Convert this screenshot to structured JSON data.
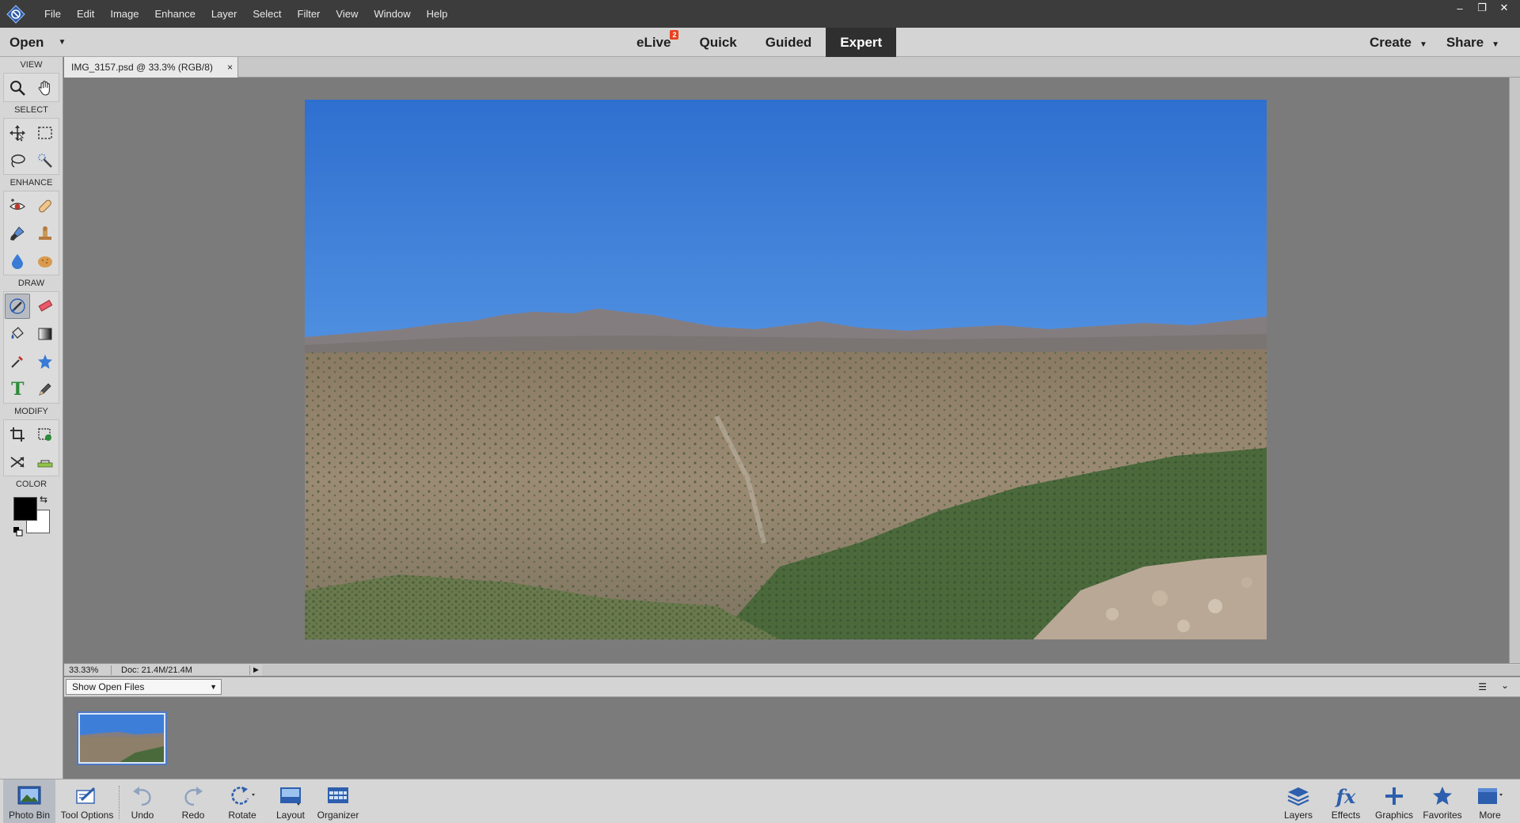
{
  "app": {
    "logo_icon": "photoshop-elements-logo-icon",
    "menu": [
      "File",
      "Edit",
      "Image",
      "Enhance",
      "Layer",
      "Select",
      "Filter",
      "View",
      "Window",
      "Help"
    ],
    "window_controls": {
      "minimize": "–",
      "restore": "❐",
      "close": "✕"
    }
  },
  "modebar": {
    "open_label": "Open",
    "tabs": [
      {
        "label": "eLive",
        "badge": "2"
      },
      {
        "label": "Quick"
      },
      {
        "label": "Guided"
      },
      {
        "label": "Expert",
        "active": true
      }
    ],
    "create_label": "Create",
    "share_label": "Share"
  },
  "toolbox": {
    "sections": {
      "view": "VIEW",
      "select": "SELECT",
      "enhance": "ENHANCE",
      "draw": "DRAW",
      "modify": "MODIFY",
      "color": "COLOR"
    },
    "foreground_color": "#000000",
    "background_color": "#ffffff"
  },
  "document": {
    "tab_title": "IMG_3157.psd @ 33.3% (RGB/8)",
    "close_glyph": "×"
  },
  "status": {
    "zoom": "33.33%",
    "doc_size": "Doc: 21.4M/21.4M"
  },
  "bin": {
    "select_value": "Show Open Files"
  },
  "taskbar": {
    "left": [
      {
        "label": "Photo Bin",
        "icon": "photo-bin-icon"
      },
      {
        "label": "Tool Options",
        "icon": "tool-options-icon"
      },
      {
        "label": "Undo",
        "icon": "undo-icon"
      },
      {
        "label": "Redo",
        "icon": "redo-icon"
      },
      {
        "label": "Rotate",
        "icon": "rotate-icon"
      },
      {
        "label": "Layout",
        "icon": "layout-icon"
      },
      {
        "label": "Organizer",
        "icon": "organizer-icon"
      }
    ],
    "right": [
      {
        "label": "Layers",
        "icon": "layers-icon"
      },
      {
        "label": "Effects",
        "icon": "effects-icon"
      },
      {
        "label": "Graphics",
        "icon": "graphics-icon"
      },
      {
        "label": "Favorites",
        "icon": "favorites-icon"
      },
      {
        "label": "More",
        "icon": "more-icon"
      }
    ]
  },
  "colors": {
    "accent": "#4d79c4",
    "badge": "#e8431e",
    "active_tab": "#2f2f2f"
  }
}
